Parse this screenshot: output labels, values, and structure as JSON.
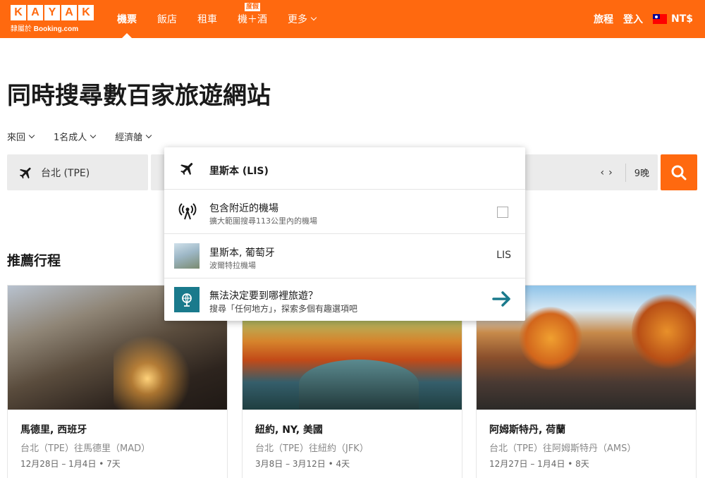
{
  "header": {
    "logo_letters": [
      "K",
      "A",
      "Y",
      "A",
      "K"
    ],
    "logo_sub_prefix": "隸屬於",
    "logo_sub_brand": "Booking.com",
    "nav": [
      {
        "label": "機票",
        "active": true
      },
      {
        "label": "飯店"
      },
      {
        "label": "租車"
      },
      {
        "label": "機＋酒",
        "badge": "度假"
      },
      {
        "label": "更多",
        "dropdown": true
      }
    ],
    "trips": "旅程",
    "login": "登入",
    "currency": "NT$",
    "brand_color": "#ff690f"
  },
  "headline": "同時搜尋數百家旅遊網站",
  "options": {
    "trip_type": "來回",
    "travelers": "1名成人",
    "cabin": "經濟艙"
  },
  "search": {
    "origin": "台北 (TPE)",
    "nights": "9晚"
  },
  "dropdown": {
    "destination": "里斯本 (LIS)",
    "nearby_title": "包含附近的機場",
    "nearby_sub": "擴大範圍搜尋113公里內的機場",
    "city_title": "里斯本, 葡萄牙",
    "city_sub": "波爾特拉機場",
    "city_code": "LIS",
    "anywhere_title": "無法決定要到哪裡旅遊？",
    "anywhere_sub": "搜尋「任何地方」，探索多個有趣選項吧"
  },
  "recommended": {
    "title": "推薦行程",
    "cards": [
      {
        "title": "馬德里, 西班牙",
        "route": "台北（TPE）往馬德里（MAD）",
        "dates": "12月28日 – 1月4日 • 7天"
      },
      {
        "title": "紐約, NY, 美國",
        "route": "台北（TPE）往紐約（JFK）",
        "dates": "3月8日 – 3月12日 • 4天"
      },
      {
        "title": "阿姆斯特丹, 荷蘭",
        "route": "台北（TPE）往阿姆斯特丹（AMS）",
        "dates": "12月27日 – 1月4日 • 8天"
      }
    ]
  }
}
